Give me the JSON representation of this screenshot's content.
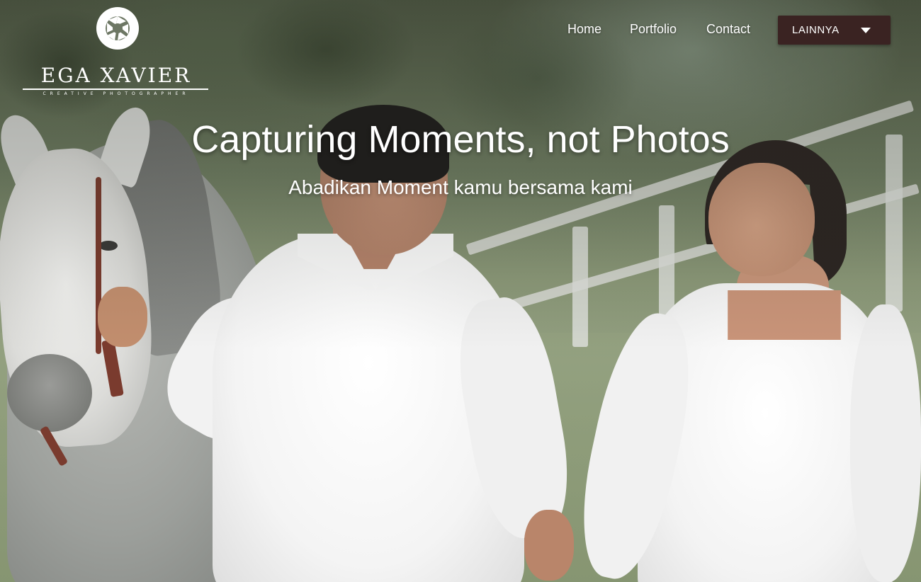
{
  "brand": {
    "name": "EGA XAVIER",
    "tagline": "CREATIVE PHOTOGRAPHER",
    "icon": "camera-aperture-icon"
  },
  "nav": {
    "items": [
      {
        "label": "Home"
      },
      {
        "label": "Portfolio"
      },
      {
        "label": "Contact"
      }
    ],
    "dropdown": {
      "label": "LAINNYA",
      "icon": "caret-down-icon"
    }
  },
  "hero": {
    "title": "Capturing Moments, not Photos",
    "subtitle": "Abadikan Moment kamu bersama kami"
  },
  "colors": {
    "dropdown_bg": "#3a2322",
    "text": "#ffffff"
  }
}
